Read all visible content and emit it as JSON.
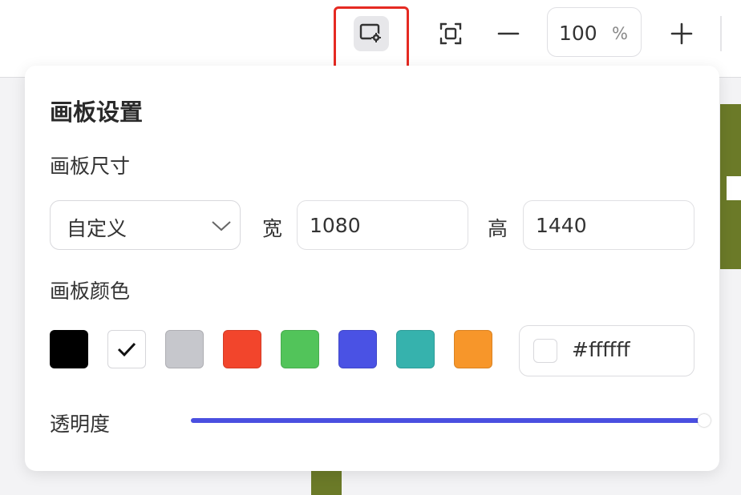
{
  "toolbar": {
    "zoom_value": "100",
    "zoom_unit": "%",
    "icons": [
      "canvas-settings-icon",
      "fit-screen-icon",
      "zoom-out-icon",
      "zoom-in-icon"
    ],
    "highlight_color": "#e52a22"
  },
  "panel": {
    "title": "画板设置",
    "size_section": {
      "label": "画板尺寸",
      "preset_value": "自定义",
      "width_label": "宽",
      "width_value": "1080",
      "height_label": "高",
      "height_value": "1440"
    },
    "color_section": {
      "label": "画板颜色",
      "swatches": [
        {
          "color": "#000000",
          "selected": false
        },
        {
          "color": "#ffffff",
          "selected": true
        },
        {
          "color": "#c6c7cc",
          "selected": false
        },
        {
          "color": "#f2452c",
          "selected": false
        },
        {
          "color": "#52c45a",
          "selected": false
        },
        {
          "color": "#4a52e4",
          "selected": false
        },
        {
          "color": "#36b2ad",
          "selected": false
        },
        {
          "color": "#f7962a",
          "selected": false
        }
      ],
      "hex_value": "#ffffff"
    },
    "opacity_section": {
      "label": "透明度",
      "value_percent": 100,
      "accent_color": "#4a4fe0"
    }
  },
  "canvas": {
    "artwork_color": "#6b7a28"
  }
}
